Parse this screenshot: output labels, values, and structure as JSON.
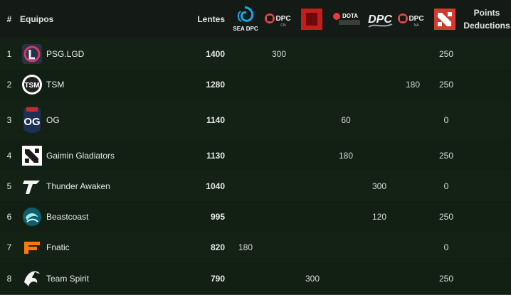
{
  "header": {
    "hash": "#",
    "teams": "Equipos",
    "points": "Lentes",
    "deductions_line1": "Points",
    "deductions_line2": "Deductions",
    "event_logos": [
      {
        "name": "sea-dpc-logo",
        "label": "SEA DPC"
      },
      {
        "name": "dpc-cn-logo",
        "label": "DPC",
        "sub": "CN"
      },
      {
        "name": "red-square-logo",
        "label": ""
      },
      {
        "name": "dota-pro-circuit-logo",
        "label": "DOTA"
      },
      {
        "name": "dpc-western-logo",
        "label": "DPC"
      },
      {
        "name": "dpc-na-logo",
        "label": "DPC",
        "sub": "NA"
      },
      {
        "name": "dota2-logo",
        "label": ""
      }
    ]
  },
  "rows": [
    {
      "rank": "1",
      "team": "PSG.LGD",
      "points": "1400",
      "cols": [
        "",
        "300",
        "",
        "",
        "",
        "",
        "250",
        ""
      ]
    },
    {
      "rank": "2",
      "team": "TSM",
      "points": "1280",
      "cols": [
        "",
        "",
        "",
        "",
        "",
        "180",
        "250",
        ""
      ]
    },
    {
      "rank": "3",
      "team": "OG",
      "points": "1140",
      "cols": [
        "",
        "",
        "",
        "60",
        "",
        "",
        "0",
        ""
      ]
    },
    {
      "rank": "4",
      "team": "Gaimin Gladiators",
      "points": "1130",
      "cols": [
        "",
        "",
        "",
        "180",
        "",
        "",
        "250",
        ""
      ]
    },
    {
      "rank": "5",
      "team": "Thunder Awaken",
      "points": "1040",
      "cols": [
        "",
        "",
        "",
        "",
        "300",
        "",
        "0",
        ""
      ]
    },
    {
      "rank": "6",
      "team": "Beastcoast",
      "points": "995",
      "cols": [
        "",
        "",
        "",
        "",
        "120",
        "",
        "250",
        ""
      ]
    },
    {
      "rank": "7",
      "team": "Fnatic",
      "points": "820",
      "cols": [
        "180",
        "",
        "",
        "",
        "",
        "",
        "0",
        ""
      ]
    },
    {
      "rank": "8",
      "team": "Team Spirit",
      "points": "790",
      "cols": [
        "",
        "",
        "300",
        "",
        "",
        "",
        "250",
        ""
      ]
    }
  ],
  "colors": {
    "header_bg": "#141a15",
    "row_bg": "#142216",
    "grid": "#2f4131",
    "text": "#e6ebe6"
  }
}
